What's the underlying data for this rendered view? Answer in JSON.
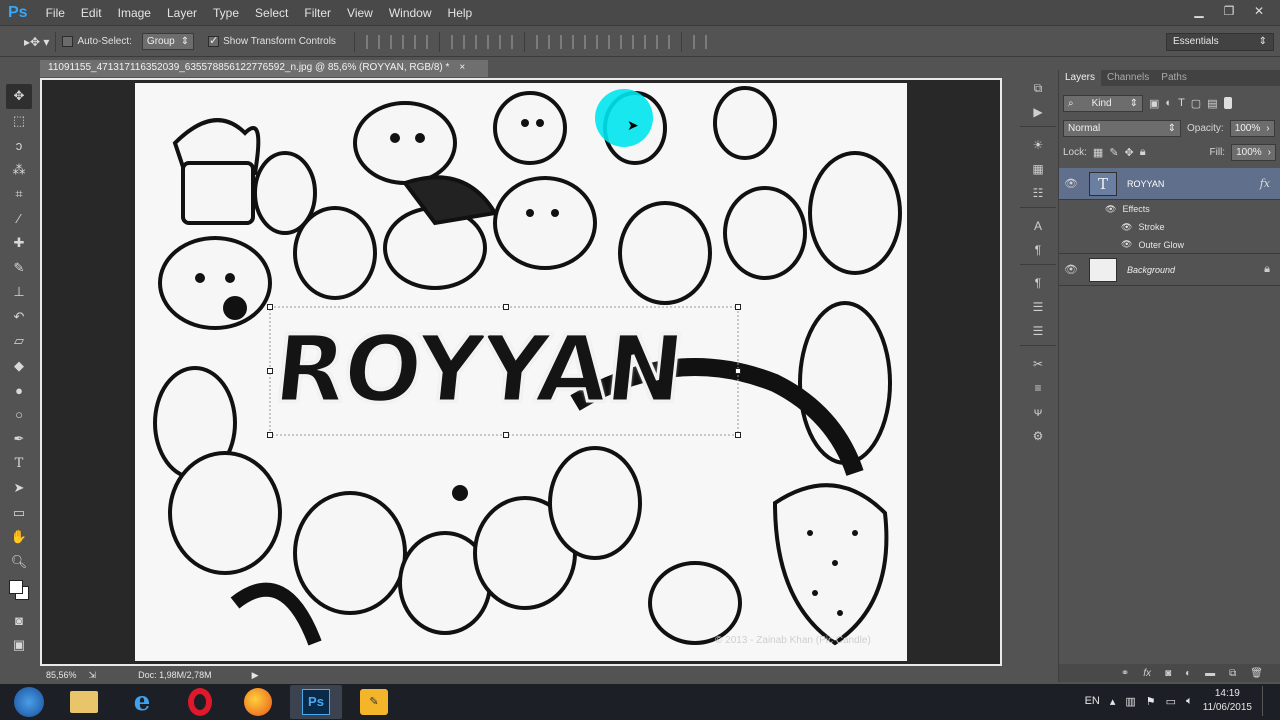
{
  "app": {
    "logo": "Ps"
  },
  "menu": [
    "File",
    "Edit",
    "Image",
    "Layer",
    "Type",
    "Select",
    "Filter",
    "View",
    "Window",
    "Help"
  ],
  "options": {
    "auto_select_label": "Auto-Select:",
    "auto_select_target": "Group",
    "show_transform_label": "Show Transform Controls",
    "workspace": "Essentials"
  },
  "document": {
    "tab_title": "11091155_471317116352039_635578856122776592_n.jpg @ 85,6% (ROYYAN, RGB/8) *",
    "canvas_text": "ROYYAN",
    "watermark": "© 2013 - Zainab Khan (Pic Candle)",
    "zoom": "85,56%",
    "doc_size": "Doc: 1,98M/2,78M"
  },
  "layers_panel": {
    "tabs": [
      "Layers",
      "Channels",
      "Paths"
    ],
    "filter_kind": "Kind",
    "blend_mode": "Normal",
    "opacity_label": "Opacity:",
    "opacity_value": "100%",
    "lock_label": "Lock:",
    "fill_label": "Fill:",
    "fill_value": "100%",
    "layers": [
      {
        "name": "ROYYAN",
        "type": "text",
        "fx": "fx",
        "selected": true
      },
      {
        "name": "Background",
        "type": "image",
        "locked": true
      }
    ],
    "effects_label": "Effects",
    "effects": [
      "Stroke",
      "Outer Glow"
    ]
  },
  "taskbar": {
    "lang": "EN",
    "time": "14:19",
    "date": "11/06/2015"
  },
  "colors": {
    "accent_selection": "#00e5f0",
    "panel_bg": "#535353",
    "layer_selected": "#5f6f8c"
  }
}
